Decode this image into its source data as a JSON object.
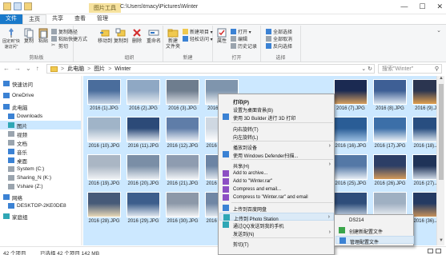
{
  "titlebar": {
    "context_tab": "图片工具",
    "path": "C:\\Users\\tmacy\\Pictures\\Winter",
    "minimize": "—",
    "maximize": "☐",
    "close": "✕"
  },
  "tabs": [
    "文件",
    "主页",
    "共享",
    "查看",
    "管理"
  ],
  "ribbon": {
    "clipboard": {
      "label": "剪贴板",
      "pin": "固定到\"快速访问\"",
      "copy": "复制",
      "paste": "粘贴",
      "copy_path": "复制路径",
      "paste_shortcut": "粘贴快捷方式",
      "cut": "剪切"
    },
    "organize": {
      "label": "组织",
      "move_to": "移动到",
      "copy_to": "复制到",
      "delete": "删除",
      "rename": "重命名"
    },
    "new": {
      "label": "新建",
      "new_folder": "新建\n文件夹",
      "new_item": "新建项目 ▾",
      "easy_access": "轻松访问 ▾"
    },
    "open": {
      "label": "打开",
      "properties": "属性",
      "open": "打开 ▾",
      "edit": "编辑",
      "history": "历史记录"
    },
    "select": {
      "label": "选择",
      "select_all": "全部选择",
      "select_none": "全部取消",
      "invert": "反向选择"
    },
    "expand": "⌄"
  },
  "address": {
    "back": "←",
    "forward": "→",
    "up_dropdown": "⌄",
    "up": "↑",
    "crumbs": [
      "此电脑",
      "图片",
      "Winter"
    ],
    "separator": ">",
    "dropdown": "⌄",
    "refresh": "↻",
    "search_placeholder": "搜索\"Winter\"",
    "search_icon": "⚲"
  },
  "nav": [
    {
      "label": "快速访问",
      "icon": "star-icon",
      "color": "#3b82d4"
    },
    {
      "label": "OneDrive",
      "icon": "cloud-icon",
      "color": "#3b82d4"
    },
    {
      "label": "此电脑",
      "icon": "computer-icon",
      "color": "#3b82d4"
    },
    {
      "label": "Downloads",
      "icon": "download-icon",
      "color": "#3b82d4"
    },
    {
      "label": "图片",
      "icon": "picture-icon",
      "color": "#2fa7b5",
      "selected": true
    },
    {
      "label": "视频",
      "icon": "video-icon",
      "color": "#9aa4ae"
    },
    {
      "label": "文档",
      "icon": "document-icon",
      "color": "#9aa4ae"
    },
    {
      "label": "音乐",
      "icon": "music-icon",
      "color": "#3b82d4"
    },
    {
      "label": "桌面",
      "icon": "desktop-icon",
      "color": "#3b82d4"
    },
    {
      "label": "System (C:)",
      "icon": "drive-icon",
      "color": "#9aa4ae"
    },
    {
      "label": "Sharing_N (K:)",
      "icon": "drive-icon",
      "color": "#9aa4ae"
    },
    {
      "label": "Vshare (Z:)",
      "icon": "network-drive-icon",
      "color": "#9aa4ae"
    },
    {
      "label": "网络",
      "icon": "network-icon",
      "color": "#3b82d4"
    },
    {
      "label": "DESKTOP-2KE0DE8",
      "icon": "computer-icon",
      "color": "#3b82d4"
    },
    {
      "label": "家庭组",
      "icon": "homegroup-icon",
      "color": "#2fa7b5"
    }
  ],
  "files": [
    {
      "name": "2016 (1).JPG",
      "colors": [
        "#4a6d9c",
        "#c8d6e6"
      ]
    },
    {
      "name": "2016 (2).JPG",
      "colors": [
        "#8fa8c4",
        "#e8eef4"
      ]
    },
    {
      "name": "2016 (3).JPG",
      "colors": [
        "#6e7d8e",
        "#d9dee4"
      ]
    },
    {
      "name": "2016 (4).JPG",
      "colors": [
        "#7f95ad",
        "#eef2f6"
      ]
    },
    {
      "name": "2016 (7).JPG",
      "colors": [
        "#1b2a52",
        "#d6a060"
      ]
    },
    {
      "name": "2016 (8).JPG",
      "colors": [
        "#3e5f95",
        "#dde6f0"
      ]
    },
    {
      "name": "2016 (9).JPG",
      "colors": [
        "#2b3550",
        "#e0a050"
      ]
    },
    {
      "name": "2016 (10).JPG",
      "colors": [
        "#a0b4c8",
        "#f2f5f8"
      ]
    },
    {
      "name": "2016 (11).JPG",
      "colors": [
        "#2c4a78",
        "#e4ebf3"
      ]
    },
    {
      "name": "2016 (12).JPG",
      "colors": [
        "#5f7da8",
        "#ecf1f6"
      ]
    },
    {
      "name": "2016 (13).JPG",
      "colors": [
        "#cfd8e2",
        "#ffffff"
      ]
    },
    {
      "name": "2016 (16).JPG",
      "colors": [
        "#2a5d96",
        "#9fc1e3"
      ]
    },
    {
      "name": "2016 (17).JPG",
      "colors": [
        "#3c6fa8",
        "#f0f4f8"
      ]
    },
    {
      "name": "2016 (18).JPG",
      "colors": [
        "#284e80",
        "#dce6f0"
      ]
    },
    {
      "name": "2016 (19).JPG",
      "colors": [
        "#aab6c4",
        "#eef1f4"
      ]
    },
    {
      "name": "2016 (20).JPG",
      "colors": [
        "#7a8ea6",
        "#e8edf2"
      ]
    },
    {
      "name": "2016 (21).JPG",
      "colors": [
        "#8e9cb0",
        "#f0f3f6"
      ]
    },
    {
      "name": "2016 (22).JPG",
      "colors": [
        "#6c84a4",
        "#dfe6ee"
      ]
    },
    {
      "name": "2016 (25).JPG",
      "colors": [
        "#5478a6",
        "#e6edf4"
      ]
    },
    {
      "name": "2016 (26).JPG",
      "colors": [
        "#2c3e66",
        "#d49a5a"
      ]
    },
    {
      "name": "2016 (27).JPG",
      "colors": [
        "#1f3358",
        "#cfd9e6"
      ]
    },
    {
      "name": "2016 (28).JPG",
      "colors": [
        "#465a78",
        "#e9d9b8"
      ]
    },
    {
      "name": "2016 (29).JPG",
      "colors": [
        "#3d5e8c",
        "#e3eaf2"
      ]
    },
    {
      "name": "2016 (30).JPG",
      "colors": [
        "#8c98a8",
        "#f3f5f7"
      ]
    },
    {
      "name": "2016 (31).JPG",
      "colors": [
        "#6f86a4",
        "#e6ecf2"
      ]
    },
    {
      "name": "",
      "colors": [
        "#2e4d7a",
        "#c9d6e4"
      ]
    },
    {
      "name": "2016 (35).JPG",
      "colors": [
        "#9fb0c2",
        "#f0f3f6"
      ]
    },
    {
      "name": "2016 (36).JPG",
      "colors": [
        "#243a62",
        "#c6915a"
      ]
    }
  ],
  "context_menu": [
    {
      "label": "打印(P)",
      "bold": true
    },
    {
      "label": "设置为桌面背景(B)"
    },
    {
      "label": "使用 3D Builder 进行 3D 打印",
      "icon": "3d-builder-icon",
      "color": "#3b82d4"
    },
    {
      "sep": true
    },
    {
      "label": "向右旋转(T)"
    },
    {
      "label": "向左旋转(L)"
    },
    {
      "sep": true
    },
    {
      "label": "播放到设备",
      "arrow": true
    },
    {
      "label": "使用 Windows Defender扫描...",
      "icon": "defender-icon",
      "color": "#3b82d4"
    },
    {
      "sep": true
    },
    {
      "label": "共享(H)",
      "arrow": true
    },
    {
      "label": "Add to archive...",
      "icon": "winrar-icon",
      "color": "#8c4fc4"
    },
    {
      "label": "Add to \"Winter.rar\"",
      "icon": "winrar-icon",
      "color": "#8c4fc4"
    },
    {
      "label": "Compress and email...",
      "icon": "winrar-icon",
      "color": "#8c4fc4"
    },
    {
      "label": "Compress to \"Winter.rar\" and email",
      "icon": "winrar-icon",
      "color": "#8c4fc4"
    },
    {
      "sep": true
    },
    {
      "label": "上传到百度网盘",
      "icon": "baidu-icon",
      "color": "#3b82d4"
    },
    {
      "label": "上传到 Photo Station",
      "icon": "photo-station-icon",
      "color": "#2fa7b5",
      "arrow": true,
      "hl": true
    },
    {
      "label": "通过QQ发送到我的手机",
      "icon": "qq-icon",
      "color": "#2fa7b5"
    },
    {
      "label": "发送到(N)",
      "arrow": true
    },
    {
      "sep": true
    },
    {
      "label": "剪切(T)"
    }
  ],
  "submenu": [
    {
      "label": "DS214"
    },
    {
      "label": "创建新配置文件",
      "icon": "add-icon",
      "color": "#3aa54a"
    },
    {
      "label": "管理配置文件",
      "icon": "manage-icon",
      "color": "#3b82d4",
      "hl": true
    }
  ],
  "status": {
    "count": "42 个项目",
    "selected": "已选择 42 个项目 142 MB"
  }
}
